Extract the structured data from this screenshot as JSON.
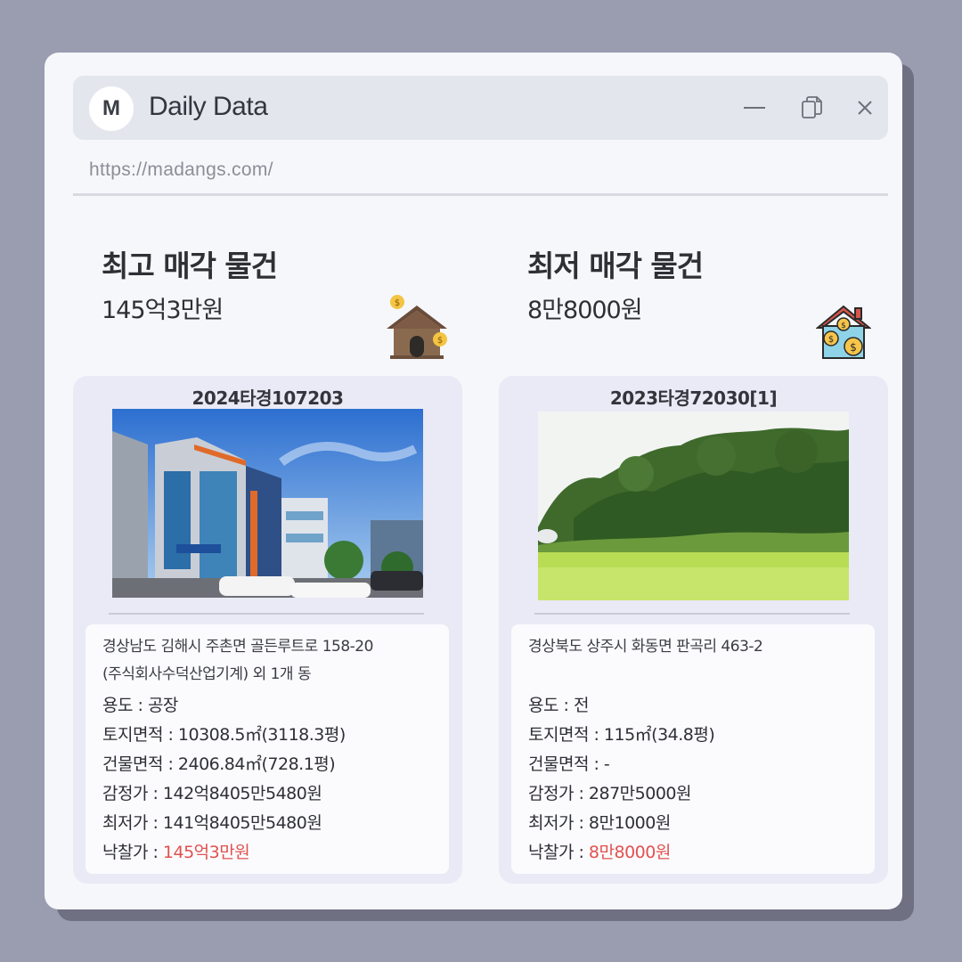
{
  "window": {
    "logo_letter": "M",
    "title": "Daily Data",
    "url": "https://madangs.com/",
    "buttons": [
      "minimize-icon",
      "copy-icon",
      "close-icon"
    ]
  },
  "highest": {
    "heading": "최고 매각 물건",
    "price": "145억3만원",
    "icon": "house-money-icon",
    "case_no": "2024타경107203",
    "address_line1": "경상남도 김해시 주촌면 골든루트로 158-20",
    "address_line2": "(주식회사수덕산업기계) 외 1개 동",
    "usage_label": "용도 : ",
    "usage": "공장",
    "land_label": "토지면적 : ",
    "land_area": "10308.5㎡(3118.3평)",
    "building_label": "건물면적 : ",
    "building_area": "2406.84㎡(728.1평)",
    "appraisal_label": "감정가 : ",
    "appraisal": "142억8405만5480원",
    "minimum_label": "최저가 : ",
    "minimum": "141억8405만5480원",
    "winning_label": "낙찰가 : ",
    "winning": "145억3만원"
  },
  "lowest": {
    "heading": "최저 매각 물건",
    "price": "8만8000원",
    "icon": "house-coins-icon",
    "case_no": "2023타경72030[1]",
    "address_line1": "경상북도 상주시 화동면 판곡리 463-2",
    "usage_label": "용도 : ",
    "usage": "전",
    "land_label": "토지면적 : ",
    "land_area": "115㎡(34.8평)",
    "building_label": "건물면적 : ",
    "building_area": "-",
    "appraisal_label": "감정가 : ",
    "appraisal": "287만5000원",
    "minimum_label": "최저가 : ",
    "minimum": "8만1000원",
    "winning_label": "낙찰가 : ",
    "winning": "8만8000원"
  },
  "colors": {
    "background": "#9a9cb0",
    "window": "#f6f7fb",
    "card": "#e9eaf5",
    "accent_price": "#e2514f"
  }
}
